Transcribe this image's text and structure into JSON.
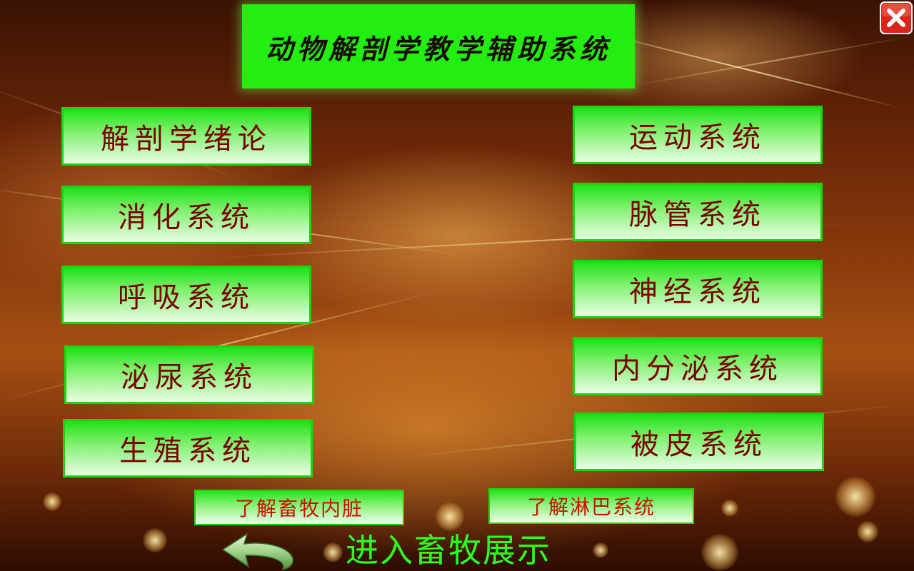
{
  "title": "动物解剖学教学辅助系统",
  "left_buttons": [
    {
      "label": "解剖学绪论"
    },
    {
      "label": "消化系统"
    },
    {
      "label": "呼吸系统"
    },
    {
      "label": "泌尿系统"
    },
    {
      "label": "生殖系统"
    }
  ],
  "right_buttons": [
    {
      "label": "运动系统"
    },
    {
      "label": "脉管系统"
    },
    {
      "label": "神经系统"
    },
    {
      "label": "内分泌系统"
    },
    {
      "label": "被皮系统"
    }
  ],
  "bottom_buttons": {
    "viscera": "了解畜牧内脏",
    "lymph": "了解淋巴系统"
  },
  "enter_showcase": "进入畜牧展示",
  "icons": {
    "close": "close-icon",
    "back": "back-arrow-icon"
  },
  "colors": {
    "button_green": "#1fe01a",
    "button_text": "#7a0000",
    "small_button_text": "#c81000",
    "enter_text": "#2cff22",
    "close_red": "#e0201a"
  }
}
